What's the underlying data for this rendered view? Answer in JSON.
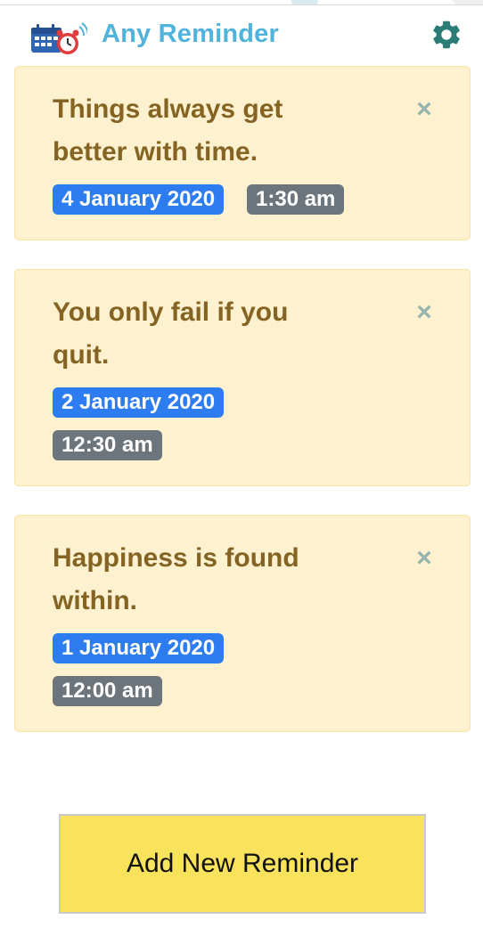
{
  "app": {
    "title": "Any Reminder"
  },
  "reminders": [
    {
      "text": "Things always get better with time.",
      "date": "4 January 2020",
      "time": "1:30 am"
    },
    {
      "text": "You only fail if you quit.",
      "date": "2 January 2020",
      "time": "12:30 am"
    },
    {
      "text": "Happiness is found within.",
      "date": "1 January 2020",
      "time": "12:00 am"
    }
  ],
  "close_glyph": "×",
  "add_button": {
    "label": "Add New Reminder"
  },
  "colors": {
    "title": "#4fb3dc",
    "card_bg": "#fdf1cf",
    "card_text": "#856423",
    "date_badge": "#2d7cf0",
    "time_badge": "#6d757c",
    "add_button": "#f9e35d",
    "gear": "#2b7b76"
  },
  "icons": {
    "logo": "calendar-alarm-icon",
    "settings": "gear-icon",
    "dismiss": "close-icon"
  }
}
